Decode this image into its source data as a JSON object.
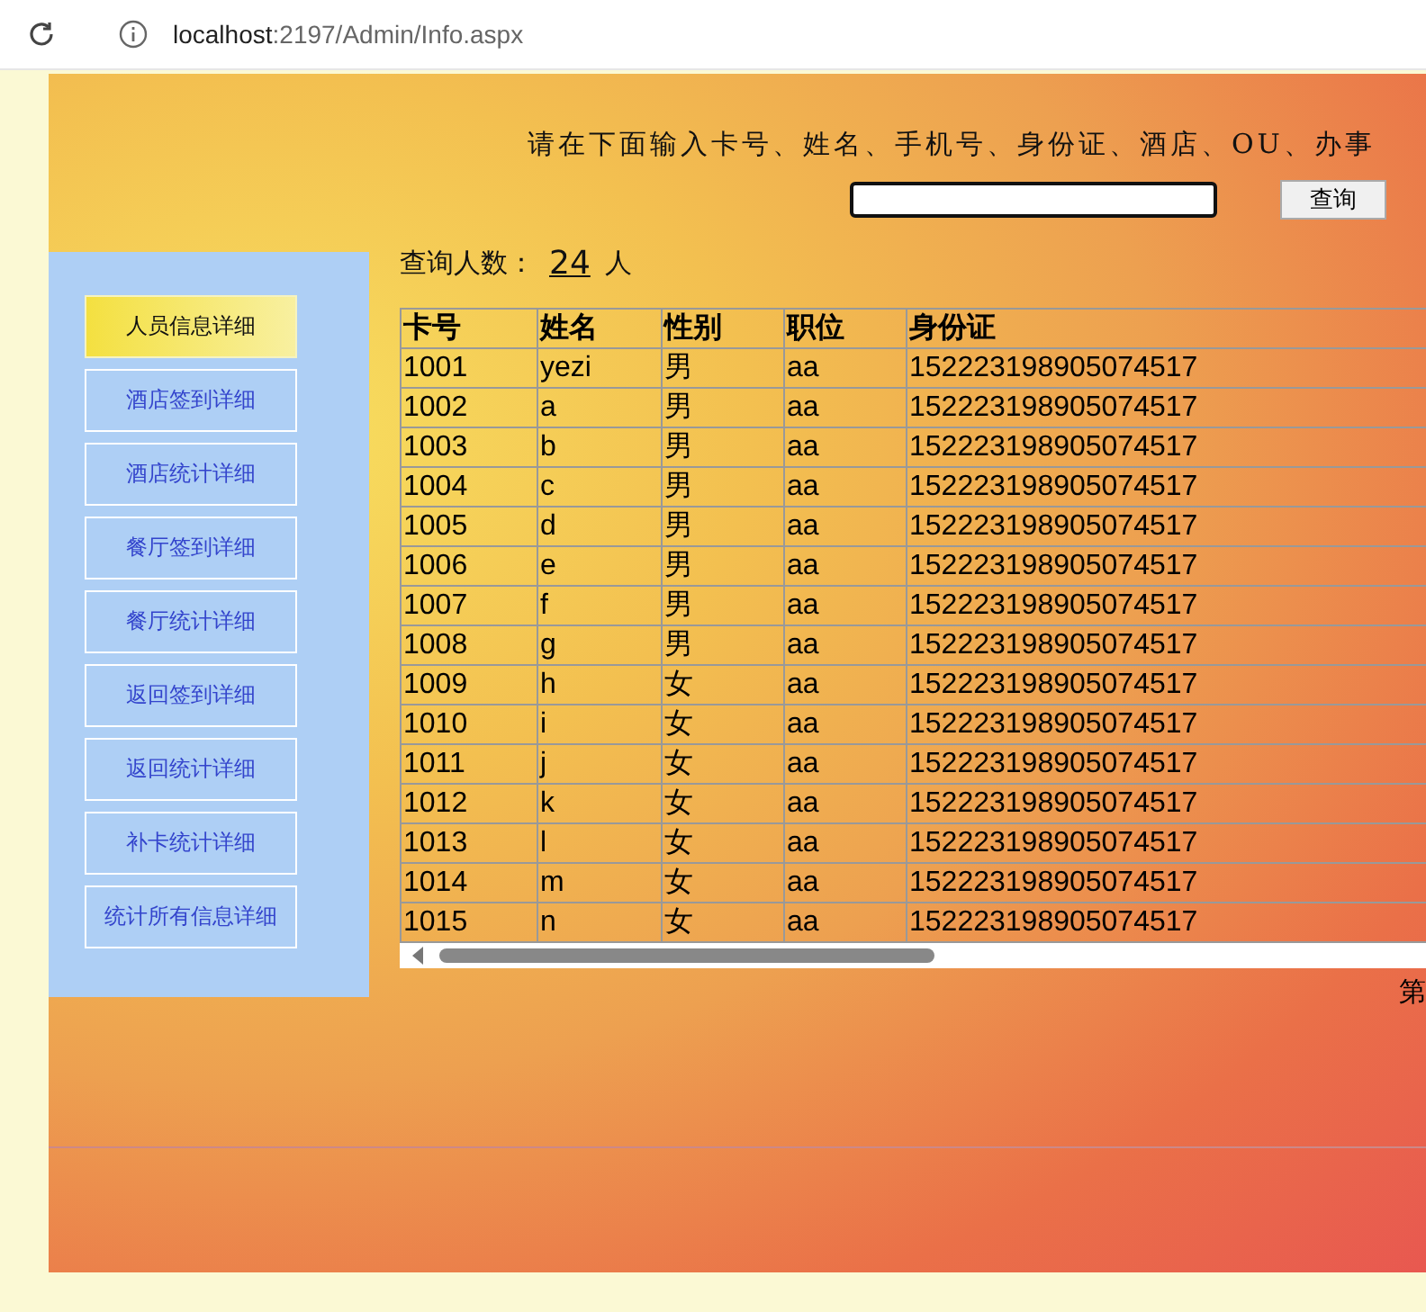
{
  "browser": {
    "url_host": "localhost",
    "url_path": ":2197/Admin/Info.aspx"
  },
  "instruction": "请在下面输入卡号、姓名、手机号、身份证、酒店、OU、办事",
  "search_button": "查询",
  "count": {
    "label": "查询人数：",
    "value": "24",
    "unit": "人"
  },
  "sidebar": {
    "items": [
      {
        "label": "人员信息详细",
        "selected": true
      },
      {
        "label": "酒店签到详细",
        "selected": false
      },
      {
        "label": "酒店统计详细",
        "selected": false
      },
      {
        "label": "餐厅签到详细",
        "selected": false
      },
      {
        "label": "餐厅统计详细",
        "selected": false
      },
      {
        "label": "返回签到详细",
        "selected": false
      },
      {
        "label": "返回统计详细",
        "selected": false
      },
      {
        "label": "补卡统计详细",
        "selected": false
      },
      {
        "label": "统计所有信息详细",
        "selected": false
      }
    ]
  },
  "table": {
    "columns": [
      "卡号",
      "姓名",
      "性别",
      "职位",
      "身份证"
    ],
    "rows": [
      [
        "1001",
        "yezi",
        "男",
        "aa",
        "152223198905074517"
      ],
      [
        "1002",
        "a",
        "男",
        "aa",
        "152223198905074517"
      ],
      [
        "1003",
        "b",
        "男",
        "aa",
        "152223198905074517"
      ],
      [
        "1004",
        "c",
        "男",
        "aa",
        "152223198905074517"
      ],
      [
        "1005",
        "d",
        "男",
        "aa",
        "152223198905074517"
      ],
      [
        "1006",
        "e",
        "男",
        "aa",
        "152223198905074517"
      ],
      [
        "1007",
        "f",
        "男",
        "aa",
        "152223198905074517"
      ],
      [
        "1008",
        "g",
        "男",
        "aa",
        "152223198905074517"
      ],
      [
        "1009",
        "h",
        "女",
        "aa",
        "152223198905074517"
      ],
      [
        "1010",
        "i",
        "女",
        "aa",
        "152223198905074517"
      ],
      [
        "1011",
        "j",
        "女",
        "aa",
        "152223198905074517"
      ],
      [
        "1012",
        "k",
        "女",
        "aa",
        "152223198905074517"
      ],
      [
        "1013",
        "l",
        "女",
        "aa",
        "152223198905074517"
      ],
      [
        "1014",
        "m",
        "女",
        "aa",
        "152223198905074517"
      ],
      [
        "1015",
        "n",
        "女",
        "aa",
        "152223198905074517"
      ]
    ]
  },
  "pager": {
    "text": "第"
  }
}
